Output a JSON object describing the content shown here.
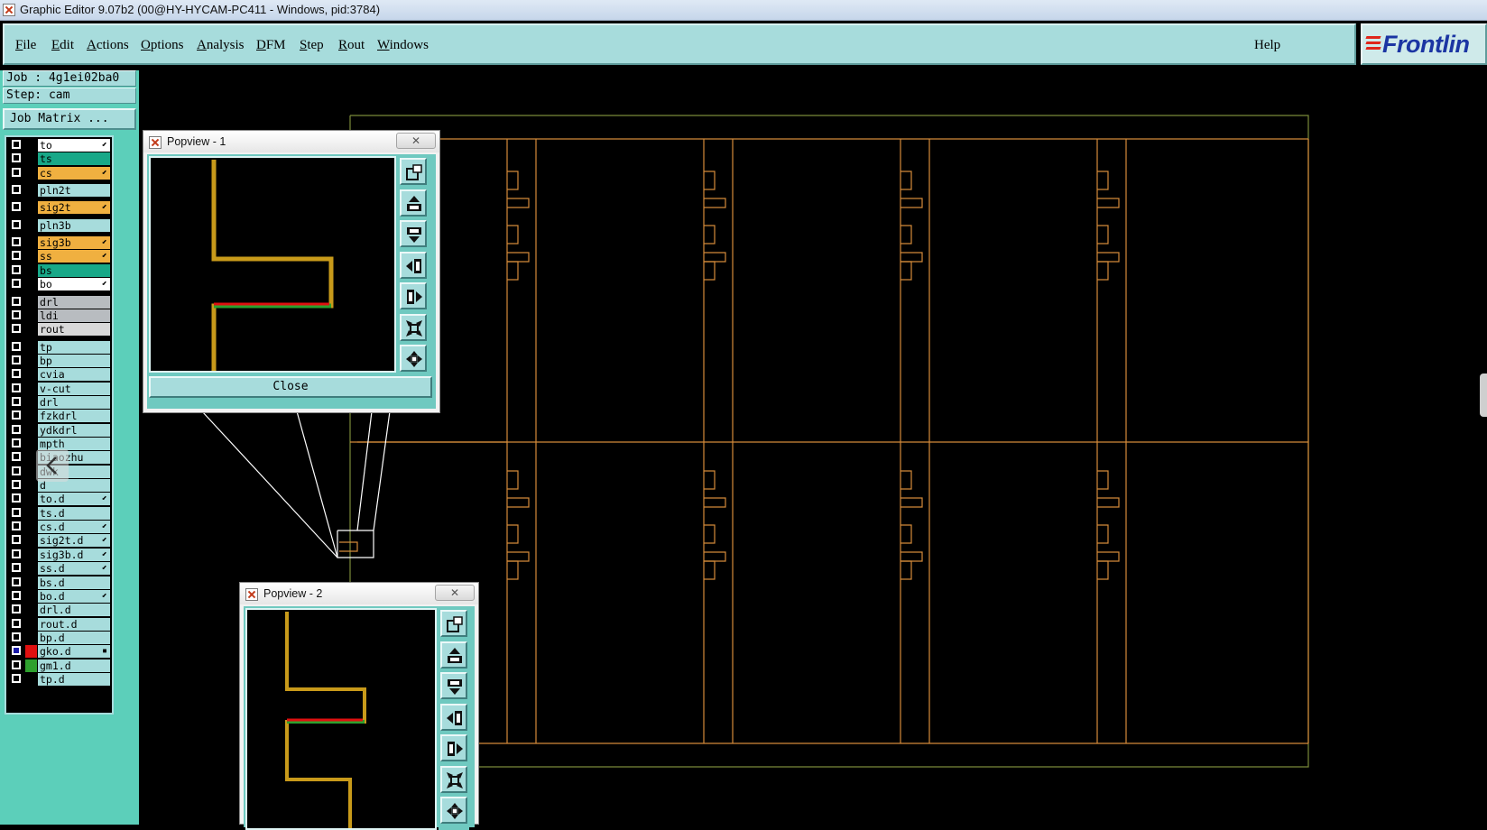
{
  "window": {
    "title": "Graphic Editor 9.07b2 (00@HY-HYCAM-PC411 - Windows, pid:3784)"
  },
  "menu": {
    "items": [
      {
        "first": "F",
        "rest": "ile"
      },
      {
        "first": "E",
        "rest": "dit"
      },
      {
        "first": "A",
        "rest": "ctions"
      },
      {
        "first": "O",
        "rest": "ptions"
      },
      {
        "first": "A",
        "rest": "nalysis"
      },
      {
        "first": "D",
        "rest": "FM"
      },
      {
        "first": "S",
        "rest": "tep"
      },
      {
        "first": "R",
        "rest": "out"
      },
      {
        "first": "W",
        "rest": "indows"
      }
    ],
    "help": "Help"
  },
  "logo": {
    "text": "Frontlin"
  },
  "job": {
    "job_label": "Job : 4g1ei02ba0",
    "step_label": "Step: cam",
    "matrix_button": "Job Matrix ..."
  },
  "colors": {
    "teal_panel": "#a7dcdc",
    "side_green": "#5ccfba",
    "trace_gold": "#c89a1a",
    "trace_red": "#e01010",
    "trace_green": "#2ea02e",
    "outline_orange": "#d48a3a",
    "outline_green": "#7a8a3a"
  },
  "layers": [
    {
      "name": "to",
      "color": "#ffffff",
      "arrow": true,
      "gap": 0
    },
    {
      "name": "ts",
      "color": "#18a888",
      "arrow": false,
      "gap": 0
    },
    {
      "name": "cs",
      "color": "#f0b040",
      "arrow": true,
      "gap": 0
    },
    {
      "name": "pln2t",
      "color": "#a7dcdc",
      "arrow": false,
      "gap": 4
    },
    {
      "name": "sig2t",
      "color": "#f0b040",
      "arrow": true,
      "gap": 4
    },
    {
      "name": "pln3b",
      "color": "#a7dcdc",
      "arrow": false,
      "gap": 4
    },
    {
      "name": "sig3b",
      "color": "#f0b040",
      "arrow": true,
      "gap": 4
    },
    {
      "name": "ss",
      "color": "#f0b040",
      "arrow": true,
      "gap": 0
    },
    {
      "name": "bs",
      "color": "#18a888",
      "arrow": false,
      "gap": 0
    },
    {
      "name": "bo",
      "color": "#ffffff",
      "arrow": true,
      "gap": 0
    },
    {
      "name": "drl",
      "color": "#b8bcc0",
      "arrow": false,
      "gap": 4
    },
    {
      "name": "ldi",
      "color": "#b8bcc0",
      "arrow": false,
      "gap": 0
    },
    {
      "name": "rout",
      "color": "#d8d8d8",
      "arrow": false,
      "gap": 0
    },
    {
      "name": "tp",
      "color": "#a7dcdc",
      "arrow": false,
      "gap": 4
    },
    {
      "name": "bp",
      "color": "#a7dcdc",
      "arrow": false,
      "gap": 0
    },
    {
      "name": "cvia",
      "color": "#a7dcdc",
      "arrow": false,
      "gap": 0
    },
    {
      "name": "v-cut",
      "color": "#a7dcdc",
      "arrow": false,
      "gap": 0
    },
    {
      "name": "drl",
      "color": "#a7dcdc",
      "arrow": false,
      "gap": 0
    },
    {
      "name": "fzkdrl",
      "color": "#a7dcdc",
      "arrow": false,
      "gap": 0
    },
    {
      "name": "ydkdrl",
      "color": "#a7dcdc",
      "arrow": false,
      "gap": 0
    },
    {
      "name": "mpth",
      "color": "#a7dcdc",
      "arrow": false,
      "gap": 0
    },
    {
      "name": "biaozhu",
      "color": "#a7dcdc",
      "arrow": false,
      "gap": 0
    },
    {
      "name": "dwk",
      "color": "#a7dcdc",
      "arrow": false,
      "gap": 0
    },
    {
      "name": "d",
      "color": "#a7dcdc",
      "arrow": false,
      "gap": 0
    },
    {
      "name": "to.d",
      "color": "#a7dcdc",
      "arrow": true,
      "gap": 0
    },
    {
      "name": "ts.d",
      "color": "#a7dcdc",
      "arrow": false,
      "gap": 0
    },
    {
      "name": "cs.d",
      "color": "#a7dcdc",
      "arrow": true,
      "gap": 0
    },
    {
      "name": "sig2t.d",
      "color": "#a7dcdc",
      "arrow": true,
      "gap": 0
    },
    {
      "name": "sig3b.d",
      "color": "#a7dcdc",
      "arrow": true,
      "gap": 0
    },
    {
      "name": "ss.d",
      "color": "#a7dcdc",
      "arrow": true,
      "gap": 0
    },
    {
      "name": "bs.d",
      "color": "#a7dcdc",
      "arrow": false,
      "gap": 0
    },
    {
      "name": "bo.d",
      "color": "#a7dcdc",
      "arrow": true,
      "gap": 0
    },
    {
      "name": "drl.d",
      "color": "#a7dcdc",
      "arrow": false,
      "gap": 0
    },
    {
      "name": "rout.d",
      "color": "#a7dcdc",
      "arrow": false,
      "gap": 0
    },
    {
      "name": "bp.d",
      "color": "#a7dcdc",
      "arrow": false,
      "gap": 0
    },
    {
      "name": "gko.d",
      "color": "#a7dcdc",
      "arrow": true,
      "gap": 0,
      "active": true,
      "swatch": "#e01010"
    },
    {
      "name": "gm1.d",
      "color": "#a7dcdc",
      "arrow": false,
      "gap": 0,
      "swatch": "#2ea02e"
    },
    {
      "name": "tp.d",
      "color": "#a7dcdc",
      "arrow": false,
      "gap": 0
    }
  ],
  "popview1": {
    "title": "Popview - 1",
    "close_label": "Close",
    "x_icon": "close-x-icon"
  },
  "popview2": {
    "title": "Popview - 2",
    "x_icon": "close-x-icon"
  },
  "toolbar_icons": [
    "zoom-window-icon",
    "pan-up-icon",
    "pan-down-icon",
    "pan-left-icon",
    "pan-right-icon",
    "zoom-fit-icon",
    "zoom-center-icon"
  ]
}
